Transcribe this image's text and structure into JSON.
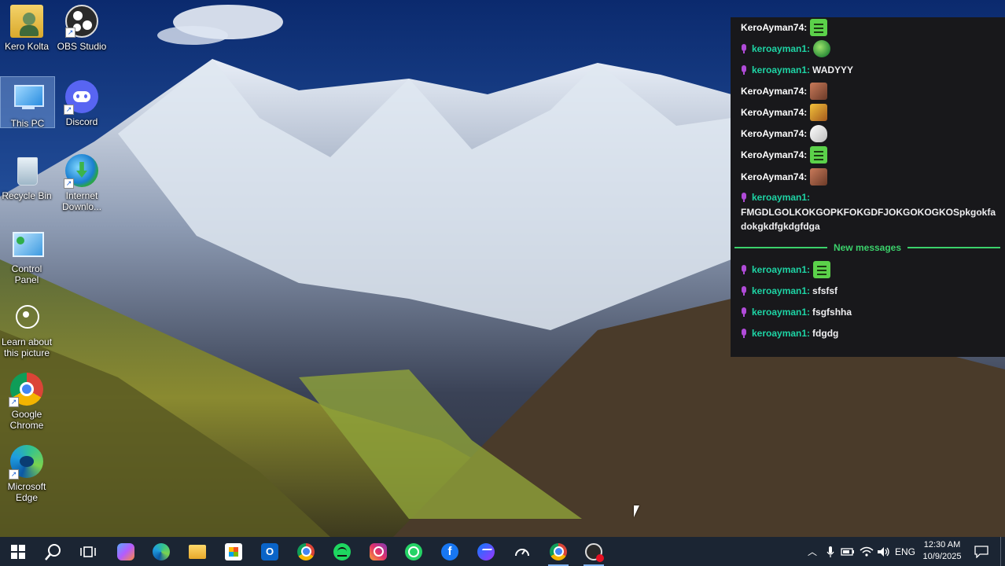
{
  "desktop_icons": [
    {
      "label": "Kero Kolta",
      "icon": "user-folder-icon"
    },
    {
      "label": "OBS Studio",
      "icon": "obs-studio-icon"
    },
    {
      "label": "This PC",
      "icon": "this-pc-icon"
    },
    {
      "label": "Discord",
      "icon": "discord-icon"
    },
    {
      "label": "Recycle Bin",
      "icon": "recycle-bin-icon"
    },
    {
      "label": "Internet Downlo...",
      "icon": "internet-download-manager-icon"
    },
    {
      "label": "Control Panel",
      "icon": "control-panel-icon"
    },
    {
      "label": "Learn about this picture",
      "icon": "learn-about-picture-icon"
    },
    {
      "label": "Google Chrome",
      "icon": "chrome-icon"
    },
    {
      "label": "Microsoft Edge",
      "icon": "edge-icon"
    }
  ],
  "chat": {
    "messages": [
      {
        "user": "KeroAyman74:",
        "text": "",
        "emote": "green-grin-emote"
      },
      {
        "user": "keroayman1:",
        "text": "",
        "emote": "globe-emote"
      },
      {
        "user": "keroayman1:",
        "text": "WADYYY",
        "emote": ""
      },
      {
        "user": "KeroAyman74:",
        "text": "",
        "emote": "face-emote"
      },
      {
        "user": "KeroAyman74:",
        "text": "",
        "emote": "yellow-emote"
      },
      {
        "user": "KeroAyman74:",
        "text": "",
        "emote": "white-emote"
      },
      {
        "user": "KeroAyman74:",
        "text": "",
        "emote": "green-grin-emote"
      },
      {
        "user": "KeroAyman74:",
        "text": "",
        "emote": "face-emote"
      },
      {
        "user": "keroayman1:",
        "text": "FMGDLGOLKOKGOPKFOKGDFJOKGOKOGKOSpkgokfadokgkdfgkdgfdga",
        "emote": ""
      }
    ],
    "divider_label": "New messages",
    "new_messages": [
      {
        "user": "keroayman1:",
        "text": "",
        "emote": "green-grin-emote"
      },
      {
        "user": "keroayman1:",
        "text": "sfsfsf",
        "emote": ""
      },
      {
        "user": "keroayman1:",
        "text": "fsgfshha",
        "emote": ""
      },
      {
        "user": "keroayman1:",
        "text": "fdgdg",
        "emote": ""
      }
    ],
    "colors": {
      "background": "#18181b",
      "mod_user": "#1ed3a4",
      "divider": "#3bd16b",
      "badge": "#b04bd8"
    }
  },
  "taskbar": {
    "apps": [
      {
        "name": "start-button",
        "icon": "windows-logo-icon"
      },
      {
        "name": "search-button",
        "icon": "search-icon"
      },
      {
        "name": "task-view-button",
        "icon": "task-view-icon"
      },
      {
        "name": "copilot-button",
        "icon": "copilot-icon"
      },
      {
        "name": "edge-button",
        "icon": "edge-icon"
      },
      {
        "name": "file-explorer-button",
        "icon": "folder-icon"
      },
      {
        "name": "store-button",
        "icon": "store-icon"
      },
      {
        "name": "outlook-button",
        "icon": "outlook-icon"
      },
      {
        "name": "chrome-button",
        "icon": "chrome-icon"
      },
      {
        "name": "spotify-button",
        "icon": "spotify-icon"
      },
      {
        "name": "instagram-button",
        "icon": "instagram-icon"
      },
      {
        "name": "whatsapp-button",
        "icon": "whatsapp-icon"
      },
      {
        "name": "facebook-button",
        "icon": "facebook-icon"
      },
      {
        "name": "messenger-button",
        "icon": "messenger-icon"
      },
      {
        "name": "speedometer-button",
        "icon": "speedometer-icon"
      },
      {
        "name": "chrome-active-button",
        "icon": "chrome-icon"
      },
      {
        "name": "obs-button",
        "icon": "obs-studio-icon"
      }
    ],
    "language": "ENG",
    "time": "12:30 AM",
    "date": "10/9/2025"
  }
}
